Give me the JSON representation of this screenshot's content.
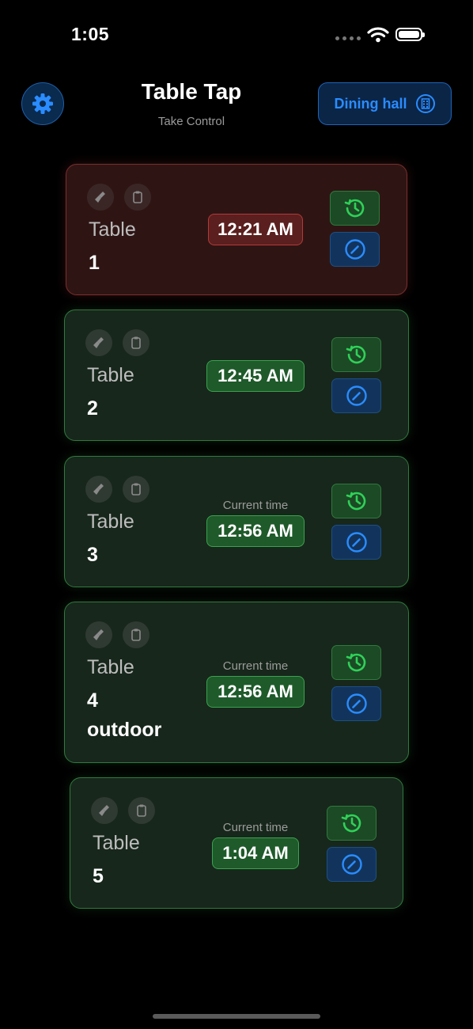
{
  "status_bar": {
    "time": "1:05"
  },
  "header": {
    "title": "Table Tap",
    "subtitle": "Take Control",
    "dining_button_label": "Dining hall"
  },
  "tables": [
    {
      "label": "Table",
      "number": "1",
      "time": "12:21 AM",
      "status": "red"
    },
    {
      "label": "Table",
      "number": "2",
      "time": "12:45 AM",
      "status": "green"
    },
    {
      "label": "Table",
      "number": "3",
      "current_label": "Current time",
      "time": "12:56 AM",
      "status": "green"
    },
    {
      "label": "Table",
      "number": "4",
      "subtitle": "outdoor",
      "current_label": "Current time",
      "time": "12:56 AM",
      "status": "green"
    },
    {
      "label": "Table",
      "number": "5",
      "current_label": "Current time",
      "time": "1:04 AM",
      "status": "green"
    }
  ],
  "colors": {
    "accent_blue": "#2a8cff",
    "success_green": "#2fd158",
    "alert_red": "#b33a38"
  },
  "icons": {
    "settings": "gear-icon",
    "dining": "building-icon",
    "clean": "broom-icon",
    "orders": "clipboard-icon",
    "history": "clock-history-icon",
    "edit": "pencil-circle-icon"
  }
}
